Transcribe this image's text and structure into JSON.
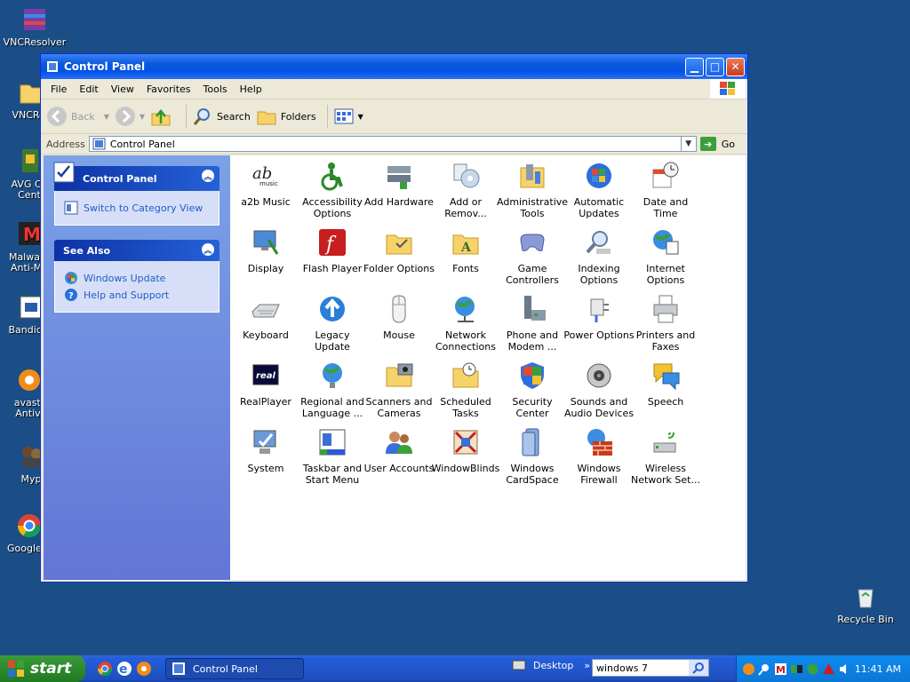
{
  "desktop": {
    "icons": [
      {
        "label": "VNCResolver"
      },
      {
        "label": "VNCRes"
      },
      {
        "label": "AVG Co",
        "label2": "Cent"
      },
      {
        "label": "Malware",
        "label2": "Anti-Ma"
      },
      {
        "label": "Bandican"
      },
      {
        "label": "avast!",
        "label2": "Antivi"
      },
      {
        "label": "Myp"
      },
      {
        "label": "Google C"
      }
    ],
    "recycle_bin": "Recycle Bin"
  },
  "window": {
    "title": "Control Panel",
    "menu": [
      "File",
      "Edit",
      "View",
      "Favorites",
      "Tools",
      "Help"
    ],
    "toolbar": {
      "back": "Back",
      "search": "Search",
      "folders": "Folders"
    },
    "address": {
      "label": "Address",
      "value": "Control Panel",
      "go": "Go"
    },
    "taskpane": {
      "panel_title": "Control Panel",
      "switch_view": "Switch to Category View",
      "see_also_title": "See Also",
      "see_also": [
        "Windows Update",
        "Help and Support"
      ]
    },
    "items": [
      {
        "l1": "a2b Music",
        "l2": ""
      },
      {
        "l1": "Accessibility",
        "l2": "Options"
      },
      {
        "l1": "Add Hardware",
        "l2": ""
      },
      {
        "l1": "Add or",
        "l2": "Remov..."
      },
      {
        "l1": "Administrative",
        "l2": "Tools"
      },
      {
        "l1": "Automatic",
        "l2": "Updates"
      },
      {
        "l1": "Date and Time",
        "l2": ""
      },
      {
        "l1": "Display",
        "l2": ""
      },
      {
        "l1": "Flash Player",
        "l2": ""
      },
      {
        "l1": "Folder Options",
        "l2": ""
      },
      {
        "l1": "Fonts",
        "l2": ""
      },
      {
        "l1": "Game",
        "l2": "Controllers"
      },
      {
        "l1": "Indexing",
        "l2": "Options"
      },
      {
        "l1": "Internet",
        "l2": "Options"
      },
      {
        "l1": "Keyboard",
        "l2": ""
      },
      {
        "l1": "Legacy",
        "l2": "Update"
      },
      {
        "l1": "Mouse",
        "l2": ""
      },
      {
        "l1": "Network",
        "l2": "Connections"
      },
      {
        "l1": "Phone and",
        "l2": "Modem ..."
      },
      {
        "l1": "Power Options",
        "l2": ""
      },
      {
        "l1": "Printers and",
        "l2": "Faxes"
      },
      {
        "l1": "RealPlayer",
        "l2": ""
      },
      {
        "l1": "Regional and",
        "l2": "Language ..."
      },
      {
        "l1": "Scanners and",
        "l2": "Cameras"
      },
      {
        "l1": "Scheduled",
        "l2": "Tasks"
      },
      {
        "l1": "Security",
        "l2": "Center"
      },
      {
        "l1": "Sounds and",
        "l2": "Audio Devices"
      },
      {
        "l1": "Speech",
        "l2": ""
      },
      {
        "l1": "System",
        "l2": ""
      },
      {
        "l1": "Taskbar and",
        "l2": "Start Menu"
      },
      {
        "l1": "User Accounts",
        "l2": ""
      },
      {
        "l1": "WindowBlinds",
        "l2": ""
      },
      {
        "l1": "Windows",
        "l2": "CardSpace"
      },
      {
        "l1": "Windows",
        "l2": "Firewall"
      },
      {
        "l1": "Wireless",
        "l2": "Network Set..."
      }
    ]
  },
  "taskbar": {
    "start": "start",
    "task_item": "Control Panel",
    "deskbar": "Desktop",
    "deskbar_chevron": "»",
    "search_value": "windows 7",
    "clock": "11:41 AM"
  },
  "colors": {
    "desktop": "#1b4e86",
    "accent": "#0452e6",
    "taskpane": "#6375d6"
  }
}
